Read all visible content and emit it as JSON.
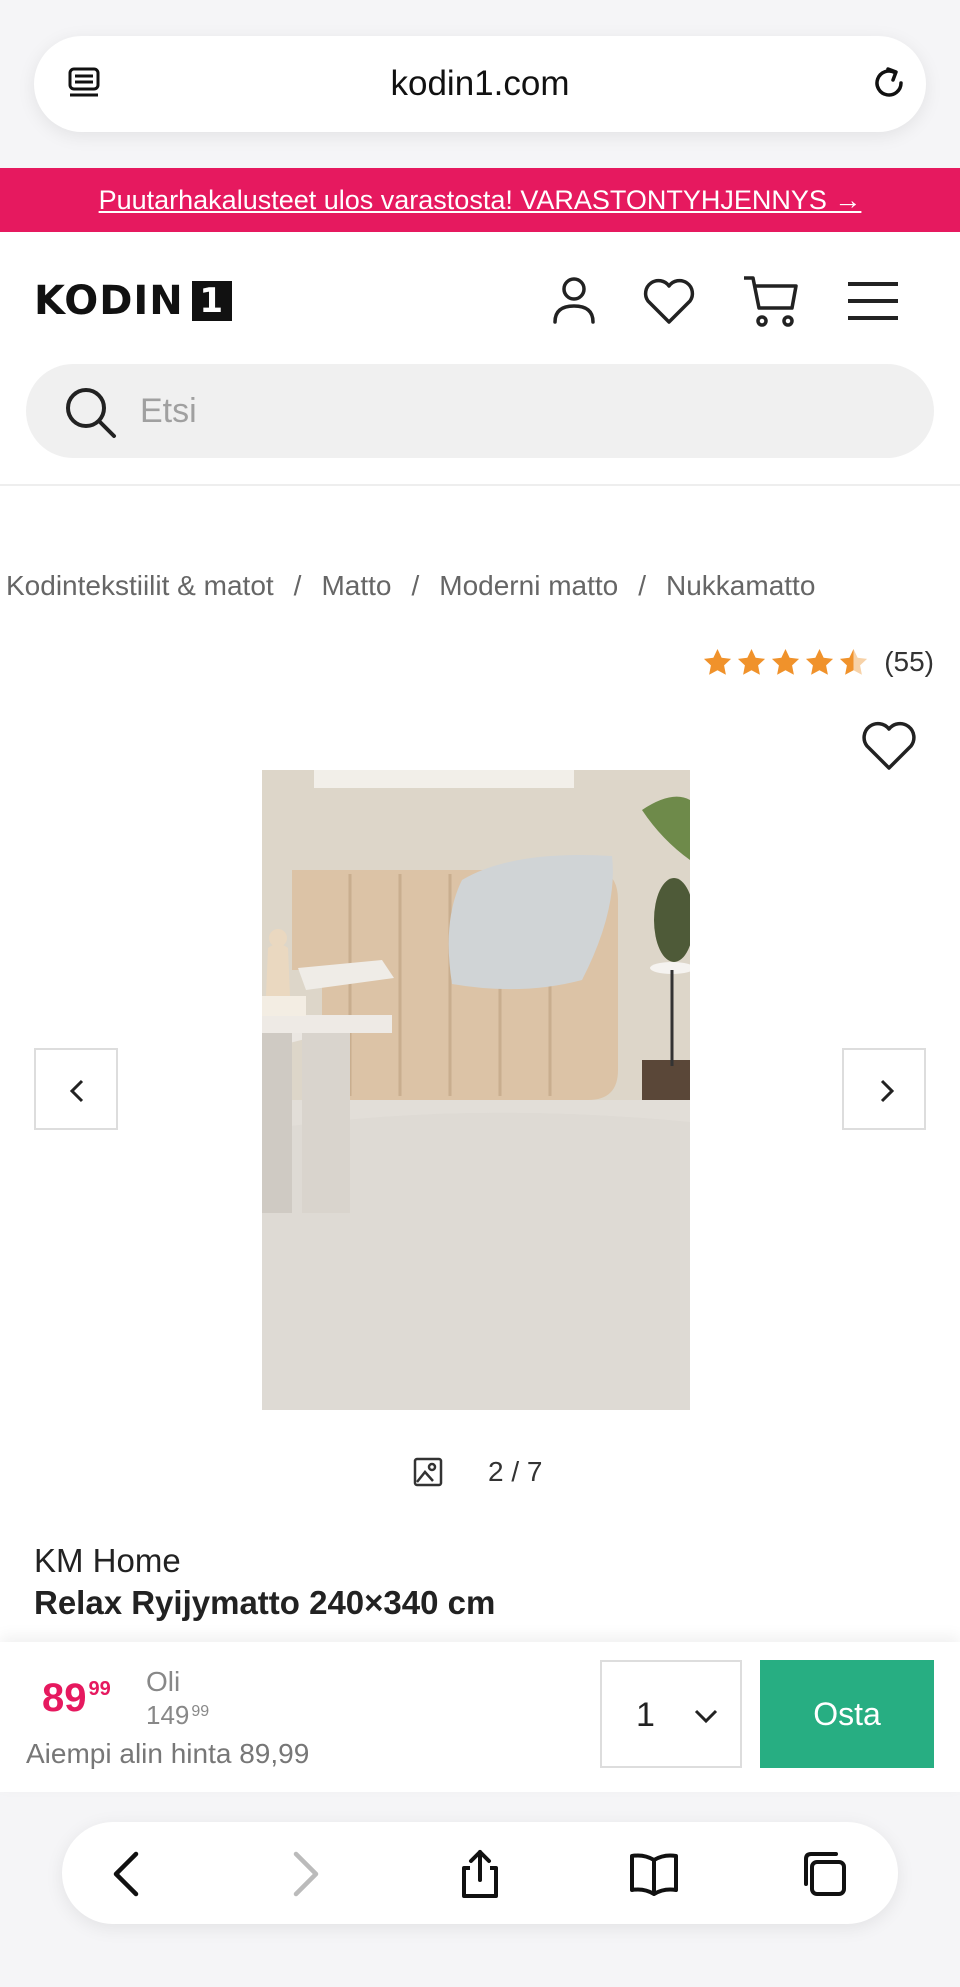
{
  "browser": {
    "url": "kodin1.com",
    "icons": {
      "tab": "tab-overview-icon",
      "reload": "reload-icon"
    }
  },
  "promo": {
    "text": "Puutarhakalusteet ulos varastosta! VARASTONTYHJENNYS →",
    "color": "#e6195f"
  },
  "header": {
    "logo_text": "KODIN",
    "logo_badge": "1",
    "icons": [
      "account-icon",
      "wishlist-icon",
      "cart-icon",
      "menu-icon"
    ]
  },
  "search": {
    "placeholder": "Etsi",
    "value": ""
  },
  "breadcrumb": [
    "Kodintekstiilit & matot",
    "Matto",
    "Moderni matto",
    "Nukkamatto"
  ],
  "breadcrumb_separator": "/",
  "rating": {
    "stars": 4.5,
    "max": 5,
    "count_label": "(55)",
    "star_color": "#f0922b"
  },
  "gallery": {
    "counter": "2 / 7"
  },
  "product": {
    "brand": "KM Home",
    "name": "Relax Ryijymatto 240×340 cm"
  },
  "buybar": {
    "price_whole": "89",
    "price_cents": "99",
    "was_label": "Oli",
    "was_whole": "149",
    "was_cents": "99",
    "lowest_label": "Aiempi alin hinta 89,99",
    "quantity": "1",
    "buy_label": "Osta",
    "buy_color": "#27ae82"
  },
  "toolbar": {
    "icons": [
      "back-icon",
      "forward-icon",
      "share-icon",
      "bookmarks-icon",
      "tabs-icon"
    ]
  }
}
